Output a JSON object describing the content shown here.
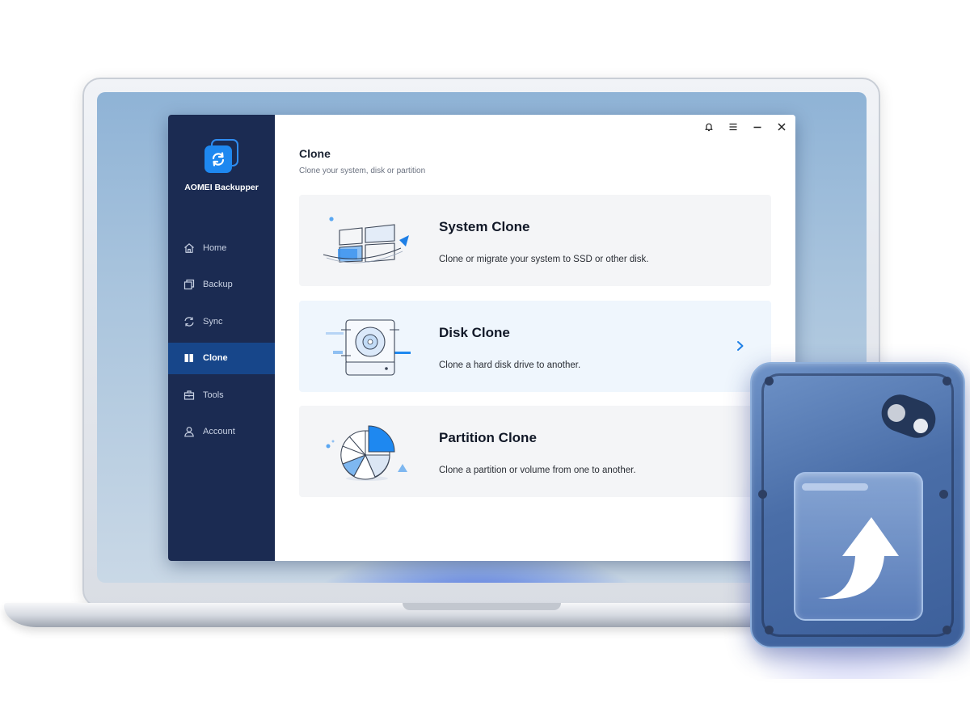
{
  "app": {
    "name": "AOMEI Backupper"
  },
  "sidebar": {
    "items": [
      {
        "label": "Home",
        "icon": "home-icon"
      },
      {
        "label": "Backup",
        "icon": "backup-icon"
      },
      {
        "label": "Sync",
        "icon": "sync-icon"
      },
      {
        "label": "Clone",
        "icon": "clone-icon",
        "active": true
      },
      {
        "label": "Tools",
        "icon": "tools-icon"
      },
      {
        "label": "Account",
        "icon": "account-icon"
      }
    ]
  },
  "window_controls": [
    "bell-icon",
    "menu-icon",
    "minimize-icon",
    "close-icon"
  ],
  "page": {
    "title": "Clone",
    "subtitle": "Clone your system, disk or partition"
  },
  "cards": [
    {
      "title": "System Clone",
      "description": "Clone or migrate your system to SSD or other disk.",
      "icon": "system-clone-illustration"
    },
    {
      "title": "Disk Clone",
      "description": "Clone a hard disk drive to another.",
      "icon": "disk-clone-illustration",
      "hovered": true
    },
    {
      "title": "Partition Clone",
      "description": "Clone a partition or volume from one to another.",
      "icon": "partition-clone-illustration"
    }
  ],
  "colors": {
    "sidebar_bg": "#1b2b52",
    "sidebar_active": "#17468a",
    "accent": "#1e88f0",
    "card_bg": "#f4f5f7",
    "card_hover_bg": "#eff6fd",
    "hdd_body": "#4a6ea8"
  }
}
